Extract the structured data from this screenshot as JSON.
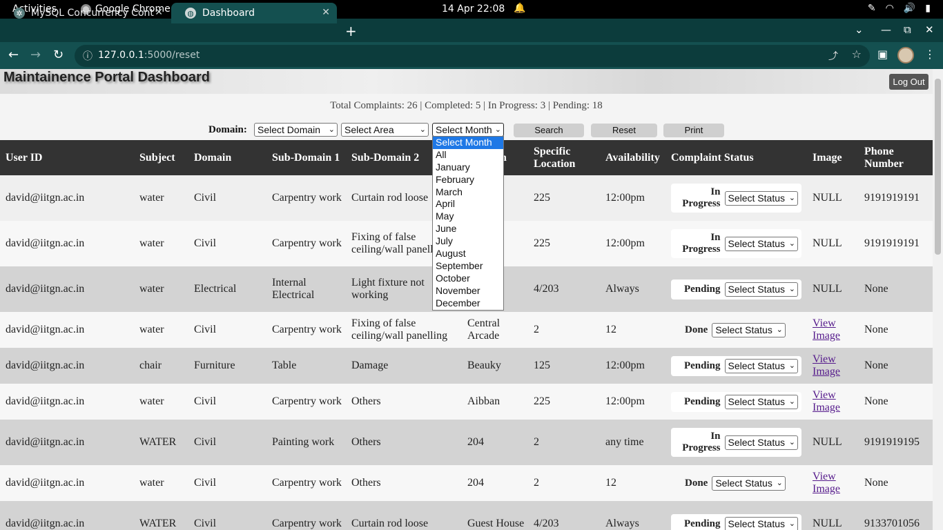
{
  "system_bar": {
    "activities": "Activities",
    "app_name": "Google Chrome",
    "clock": "14 Apr  22:08"
  },
  "browser": {
    "tabs": [
      {
        "title": "MySQL Concurrency Cont",
        "active": false
      },
      {
        "title": "Dashboard",
        "active": true
      }
    ],
    "url_host": "127.0.0.1",
    "url_path": ":5000/reset"
  },
  "page": {
    "title": "Maintainence Portal Dashboard",
    "logout_label": "Log Out",
    "stats": "Total Complaints: 26 | Completed: 5 | In Progress: 3 | Pending: 18",
    "filter_label": "Domain:",
    "domain_select": "Select Domain",
    "area_select": "Select Area",
    "month_select": "Select Month",
    "search_label": "Search",
    "reset_label": "Reset",
    "print_label": "Print"
  },
  "month_options": [
    "Select Month",
    "All",
    "January",
    "February",
    "March",
    "April",
    "May",
    "June",
    "July",
    "August",
    "September",
    "October",
    "November",
    "December"
  ],
  "table": {
    "headers": {
      "user_id": "User ID",
      "subject": "Subject",
      "domain": "Domain",
      "sub1": "Sub-Domain 1",
      "sub2": "Sub-Domain 2",
      "location": "Location",
      "location_visible": "n",
      "specific1": "Specific",
      "specific2": "Location",
      "availability": "Availability",
      "status": "Complaint Status",
      "image": "Image",
      "phone1": "Phone",
      "phone2": "Number"
    },
    "status_select": "Select Status",
    "view_image1": "View",
    "view_image2": "Image",
    "rows": [
      {
        "user": "david@iitgn.ac.in",
        "subject": "water",
        "domain": "Civil",
        "sub1": "Carpentry work",
        "sub2": "Curtain rod loose",
        "location": "",
        "specific": "225",
        "availability": "12:00pm",
        "status1": "In",
        "status2": "Progress",
        "image": "NULL",
        "phone": "9191919191"
      },
      {
        "user": "david@iitgn.ac.in",
        "subject": "water",
        "domain": "Civil",
        "sub1": "Carpentry work",
        "sub2": "Fixing of false ceiling/wall panelling",
        "location": "",
        "specific": "225",
        "availability": "12:00pm",
        "status1": "In",
        "status2": "Progress",
        "image": "NULL",
        "phone": "9191919191"
      },
      {
        "user": "david@iitgn.ac.in",
        "subject": "water",
        "domain": "Electrical",
        "sub1": "Internal Electrical",
        "sub2": "Light fixture not working",
        "location": "",
        "specific": "4/203",
        "availability": "Always",
        "status1": "Pending",
        "status2": "",
        "image": "NULL",
        "phone": "None"
      },
      {
        "user": "david@iitgn.ac.in",
        "subject": "water",
        "domain": "Civil",
        "sub1": "Carpentry work",
        "sub2": "Fixing of false ceiling/wall panelling",
        "location": "Central Arcade",
        "specific": "2",
        "availability": "12",
        "status1": "Done",
        "status2": "",
        "image": "View Image",
        "phone": "None"
      },
      {
        "user": "david@iitgn.ac.in",
        "subject": "chair",
        "domain": "Furniture",
        "sub1": "Table",
        "sub2": "Damage",
        "location": "Beauky",
        "specific": "125",
        "availability": "12:00pm",
        "status1": "Pending",
        "status2": "",
        "image": "View Image",
        "phone": "None"
      },
      {
        "user": "david@iitgn.ac.in",
        "subject": "water",
        "domain": "Civil",
        "sub1": "Carpentry work",
        "sub2": "Others",
        "location": "Aibban",
        "specific": "225",
        "availability": "12:00pm",
        "status1": "Pending",
        "status2": "",
        "image": "View Image",
        "phone": "None"
      },
      {
        "user": "david@iitgn.ac.in",
        "subject": "WATER",
        "domain": "Civil",
        "sub1": "Painting work",
        "sub2": "Others",
        "location": "204",
        "specific": "2",
        "availability": "any time",
        "status1": "In",
        "status2": "Progress",
        "image": "NULL",
        "phone": "9191919195"
      },
      {
        "user": "david@iitgn.ac.in",
        "subject": "water",
        "domain": "Civil",
        "sub1": "Carpentry work",
        "sub2": "Others",
        "location": "204",
        "specific": "2",
        "availability": "12",
        "status1": "Done",
        "status2": "",
        "image": "View Image",
        "phone": "None"
      },
      {
        "user": "david@iitgn.ac.in",
        "subject": "WATER",
        "domain": "Civil",
        "sub1": "Carpentry work",
        "sub2": "Curtain rod loose",
        "location": "Guest House",
        "specific": "4/203",
        "availability": "Always",
        "status1": "Pending",
        "status2": "",
        "image": "NULL",
        "phone": "9133701056"
      }
    ]
  }
}
